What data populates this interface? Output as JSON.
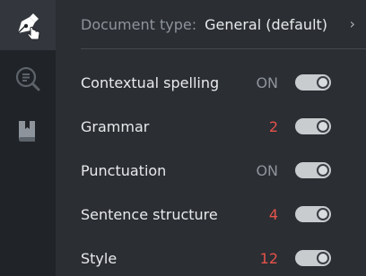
{
  "sidebar": {
    "items": [
      {
        "name": "pen-nib-icon",
        "active": true
      },
      {
        "name": "search-document-icon",
        "active": false
      },
      {
        "name": "bookmark-book-icon",
        "active": false
      }
    ]
  },
  "document_type": {
    "label": "Document type:",
    "value": "General (default)"
  },
  "settings": [
    {
      "label": "Contextual spelling",
      "status": "ON",
      "toggle_on": true
    },
    {
      "label": "Grammar",
      "status": "2",
      "toggle_on": true
    },
    {
      "label": "Punctuation",
      "status": "ON",
      "toggle_on": true
    },
    {
      "label": "Sentence structure",
      "status": "4",
      "toggle_on": true
    },
    {
      "label": "Style",
      "status": "12",
      "toggle_on": true
    }
  ],
  "colors": {
    "sidebar_bg": "#202327",
    "panel_bg": "#2b2e33",
    "count_red": "#e5534b",
    "muted_text": "#8e949b"
  }
}
